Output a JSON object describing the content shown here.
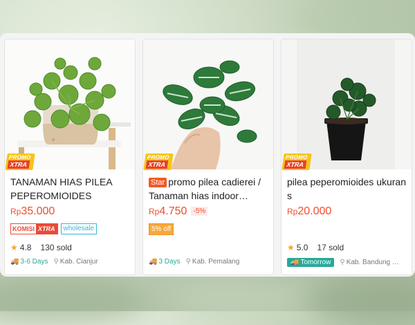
{
  "products": [
    {
      "promo_label_top": "PROMO",
      "promo_label_bottom": "XTRA",
      "title": "TANAMAN HIAS PILEA PEPEROMIOIDES",
      "price_currency": "Rp",
      "price_value": "35.000",
      "komisi_a": "KOMISI",
      "komisi_b": "XTRA",
      "wholesale": "wholesale",
      "rating": "4.8",
      "sold": "130 sold",
      "delivery": "3-6 Days",
      "location": "Kab. Cianjur"
    },
    {
      "promo_label_top": "PROMO",
      "promo_label_bottom": "XTRA",
      "star_tag": "Star",
      "title": "promo pilea cadierei / Tanaman hias indoor…",
      "price_currency": "Rp",
      "price_value": "4.750",
      "discount": "-5%",
      "off_badge": "5% off",
      "delivery": "3 Days",
      "location": "Kab. Pemalang"
    },
    {
      "promo_label_top": "PROMO",
      "promo_label_bottom": "XTRA",
      "title": "pilea peperomioides ukuran s",
      "price_currency": "Rp",
      "price_value": "20.000",
      "rating": "5.0",
      "sold": "17 sold",
      "delivery": "Tomorrow",
      "location": "Kab. Bandung …"
    }
  ]
}
